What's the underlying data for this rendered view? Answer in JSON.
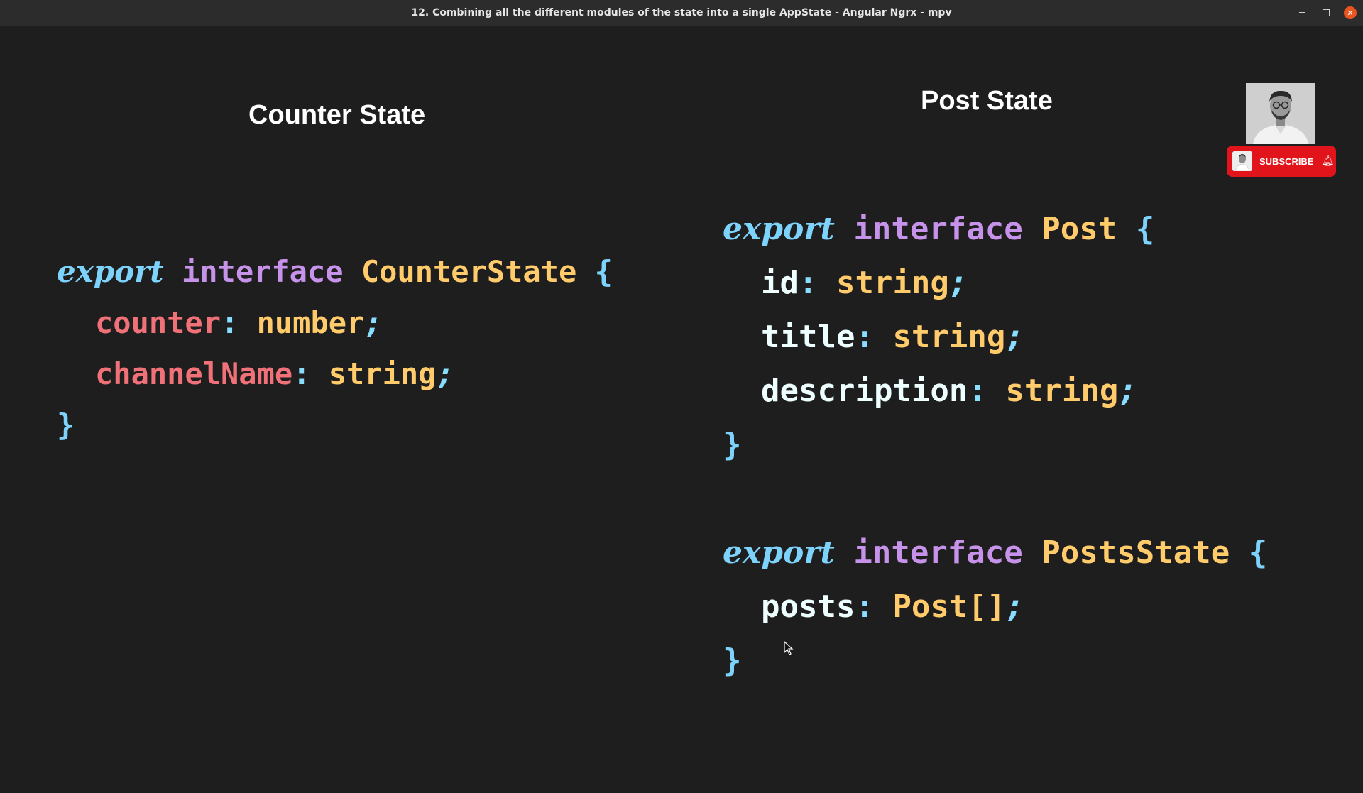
{
  "window": {
    "title": "12. Combining all the different modules of the state into a single AppState - Angular Ngrx - mpv",
    "minimize_icon": "minimize-icon",
    "maximize_icon": "maximize-icon",
    "close_icon": "close-icon",
    "close_color": "#e95420"
  },
  "slide": {
    "left_heading": "Counter State",
    "right_heading": "Post State",
    "counter_code": {
      "export": "export",
      "interface": "interface",
      "name": "CounterState",
      "open": "{",
      "close": "}",
      "props": [
        {
          "name": "counter",
          "type": "number"
        },
        {
          "name": "channelName",
          "type": "string"
        }
      ]
    },
    "post_code": {
      "export": "export",
      "interface": "interface",
      "name": "Post",
      "open": "{",
      "close": "}",
      "props": [
        {
          "name": "id",
          "type": "string"
        },
        {
          "name": "title",
          "type": "string"
        },
        {
          "name": "description",
          "type": "string"
        }
      ]
    },
    "posts_state_code": {
      "export": "export",
      "interface": "interface",
      "name": "PostsState",
      "open": "{",
      "close": "}",
      "props": [
        {
          "name": "posts",
          "type": "Post[]"
        }
      ]
    },
    "colors": {
      "background": "#1e1e1e",
      "export": "#7dd3fc",
      "interface": "#c792ea",
      "type": "#ffcb6b",
      "property_counter": "#f07178",
      "property_post": "#eeffff"
    }
  },
  "overlay": {
    "subscribe_label": "SUBSCRIBE",
    "bell_icon": "bell-icon",
    "subscribe_color": "#e1141c"
  }
}
